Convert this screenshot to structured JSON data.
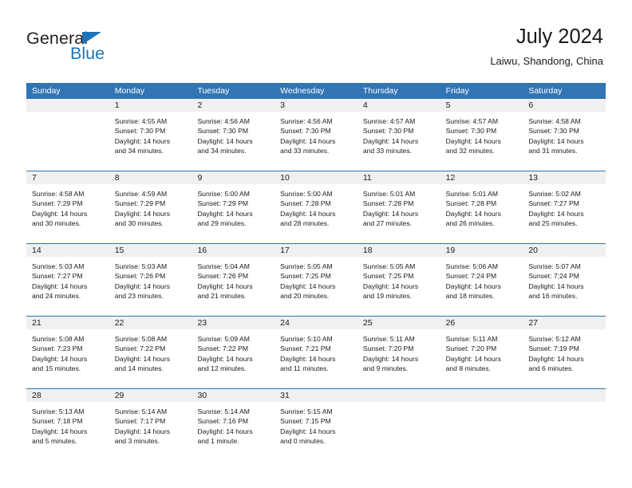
{
  "brand": {
    "name_top": "General",
    "name_bottom": "Blue",
    "triangle_color": "#1b75bb"
  },
  "header": {
    "month_title": "July 2024",
    "location": "Laiwu, Shandong, China"
  },
  "theme": {
    "header_blue": "#3175b5",
    "row_divider_blue": "#2e74b5",
    "daynum_band": "#f0f0f0"
  },
  "calendar": {
    "weekday_headers": [
      "Sunday",
      "Monday",
      "Tuesday",
      "Wednesday",
      "Thursday",
      "Friday",
      "Saturday"
    ],
    "weeks": [
      [
        {
          "day": "",
          "sunrise": "",
          "sunset": "",
          "daylight_1": "",
          "daylight_2": ""
        },
        {
          "day": "1",
          "sunrise": "Sunrise: 4:55 AM",
          "sunset": "Sunset: 7:30 PM",
          "daylight_1": "Daylight: 14 hours",
          "daylight_2": "and 34 minutes."
        },
        {
          "day": "2",
          "sunrise": "Sunrise: 4:56 AM",
          "sunset": "Sunset: 7:30 PM",
          "daylight_1": "Daylight: 14 hours",
          "daylight_2": "and 34 minutes."
        },
        {
          "day": "3",
          "sunrise": "Sunrise: 4:56 AM",
          "sunset": "Sunset: 7:30 PM",
          "daylight_1": "Daylight: 14 hours",
          "daylight_2": "and 33 minutes."
        },
        {
          "day": "4",
          "sunrise": "Sunrise: 4:57 AM",
          "sunset": "Sunset: 7:30 PM",
          "daylight_1": "Daylight: 14 hours",
          "daylight_2": "and 33 minutes."
        },
        {
          "day": "5",
          "sunrise": "Sunrise: 4:57 AM",
          "sunset": "Sunset: 7:30 PM",
          "daylight_1": "Daylight: 14 hours",
          "daylight_2": "and 32 minutes."
        },
        {
          "day": "6",
          "sunrise": "Sunrise: 4:58 AM",
          "sunset": "Sunset: 7:30 PM",
          "daylight_1": "Daylight: 14 hours",
          "daylight_2": "and 31 minutes."
        }
      ],
      [
        {
          "day": "7",
          "sunrise": "Sunrise: 4:58 AM",
          "sunset": "Sunset: 7:29 PM",
          "daylight_1": "Daylight: 14 hours",
          "daylight_2": "and 30 minutes."
        },
        {
          "day": "8",
          "sunrise": "Sunrise: 4:59 AM",
          "sunset": "Sunset: 7:29 PM",
          "daylight_1": "Daylight: 14 hours",
          "daylight_2": "and 30 minutes."
        },
        {
          "day": "9",
          "sunrise": "Sunrise: 5:00 AM",
          "sunset": "Sunset: 7:29 PM",
          "daylight_1": "Daylight: 14 hours",
          "daylight_2": "and 29 minutes."
        },
        {
          "day": "10",
          "sunrise": "Sunrise: 5:00 AM",
          "sunset": "Sunset: 7:28 PM",
          "daylight_1": "Daylight: 14 hours",
          "daylight_2": "and 28 minutes."
        },
        {
          "day": "11",
          "sunrise": "Sunrise: 5:01 AM",
          "sunset": "Sunset: 7:28 PM",
          "daylight_1": "Daylight: 14 hours",
          "daylight_2": "and 27 minutes."
        },
        {
          "day": "12",
          "sunrise": "Sunrise: 5:01 AM",
          "sunset": "Sunset: 7:28 PM",
          "daylight_1": "Daylight: 14 hours",
          "daylight_2": "and 26 minutes."
        },
        {
          "day": "13",
          "sunrise": "Sunrise: 5:02 AM",
          "sunset": "Sunset: 7:27 PM",
          "daylight_1": "Daylight: 14 hours",
          "daylight_2": "and 25 minutes."
        }
      ],
      [
        {
          "day": "14",
          "sunrise": "Sunrise: 5:03 AM",
          "sunset": "Sunset: 7:27 PM",
          "daylight_1": "Daylight: 14 hours",
          "daylight_2": "and 24 minutes."
        },
        {
          "day": "15",
          "sunrise": "Sunrise: 5:03 AM",
          "sunset": "Sunset: 7:26 PM",
          "daylight_1": "Daylight: 14 hours",
          "daylight_2": "and 23 minutes."
        },
        {
          "day": "16",
          "sunrise": "Sunrise: 5:04 AM",
          "sunset": "Sunset: 7:26 PM",
          "daylight_1": "Daylight: 14 hours",
          "daylight_2": "and 21 minutes."
        },
        {
          "day": "17",
          "sunrise": "Sunrise: 5:05 AM",
          "sunset": "Sunset: 7:25 PM",
          "daylight_1": "Daylight: 14 hours",
          "daylight_2": "and 20 minutes."
        },
        {
          "day": "18",
          "sunrise": "Sunrise: 5:05 AM",
          "sunset": "Sunset: 7:25 PM",
          "daylight_1": "Daylight: 14 hours",
          "daylight_2": "and 19 minutes."
        },
        {
          "day": "19",
          "sunrise": "Sunrise: 5:06 AM",
          "sunset": "Sunset: 7:24 PM",
          "daylight_1": "Daylight: 14 hours",
          "daylight_2": "and 18 minutes."
        },
        {
          "day": "20",
          "sunrise": "Sunrise: 5:07 AM",
          "sunset": "Sunset: 7:24 PM",
          "daylight_1": "Daylight: 14 hours",
          "daylight_2": "and 16 minutes."
        }
      ],
      [
        {
          "day": "21",
          "sunrise": "Sunrise: 5:08 AM",
          "sunset": "Sunset: 7:23 PM",
          "daylight_1": "Daylight: 14 hours",
          "daylight_2": "and 15 minutes."
        },
        {
          "day": "22",
          "sunrise": "Sunrise: 5:08 AM",
          "sunset": "Sunset: 7:22 PM",
          "daylight_1": "Daylight: 14 hours",
          "daylight_2": "and 14 minutes."
        },
        {
          "day": "23",
          "sunrise": "Sunrise: 5:09 AM",
          "sunset": "Sunset: 7:22 PM",
          "daylight_1": "Daylight: 14 hours",
          "daylight_2": "and 12 minutes."
        },
        {
          "day": "24",
          "sunrise": "Sunrise: 5:10 AM",
          "sunset": "Sunset: 7:21 PM",
          "daylight_1": "Daylight: 14 hours",
          "daylight_2": "and 11 minutes."
        },
        {
          "day": "25",
          "sunrise": "Sunrise: 5:11 AM",
          "sunset": "Sunset: 7:20 PM",
          "daylight_1": "Daylight: 14 hours",
          "daylight_2": "and 9 minutes."
        },
        {
          "day": "26",
          "sunrise": "Sunrise: 5:11 AM",
          "sunset": "Sunset: 7:20 PM",
          "daylight_1": "Daylight: 14 hours",
          "daylight_2": "and 8 minutes."
        },
        {
          "day": "27",
          "sunrise": "Sunrise: 5:12 AM",
          "sunset": "Sunset: 7:19 PM",
          "daylight_1": "Daylight: 14 hours",
          "daylight_2": "and 6 minutes."
        }
      ],
      [
        {
          "day": "28",
          "sunrise": "Sunrise: 5:13 AM",
          "sunset": "Sunset: 7:18 PM",
          "daylight_1": "Daylight: 14 hours",
          "daylight_2": "and 5 minutes."
        },
        {
          "day": "29",
          "sunrise": "Sunrise: 5:14 AM",
          "sunset": "Sunset: 7:17 PM",
          "daylight_1": "Daylight: 14 hours",
          "daylight_2": "and 3 minutes."
        },
        {
          "day": "30",
          "sunrise": "Sunrise: 5:14 AM",
          "sunset": "Sunset: 7:16 PM",
          "daylight_1": "Daylight: 14 hours",
          "daylight_2": "and 1 minute."
        },
        {
          "day": "31",
          "sunrise": "Sunrise: 5:15 AM",
          "sunset": "Sunset: 7:15 PM",
          "daylight_1": "Daylight: 14 hours",
          "daylight_2": "and 0 minutes."
        },
        {
          "day": "",
          "sunrise": "",
          "sunset": "",
          "daylight_1": "",
          "daylight_2": ""
        },
        {
          "day": "",
          "sunrise": "",
          "sunset": "",
          "daylight_1": "",
          "daylight_2": ""
        },
        {
          "day": "",
          "sunrise": "",
          "sunset": "",
          "daylight_1": "",
          "daylight_2": ""
        }
      ]
    ]
  }
}
